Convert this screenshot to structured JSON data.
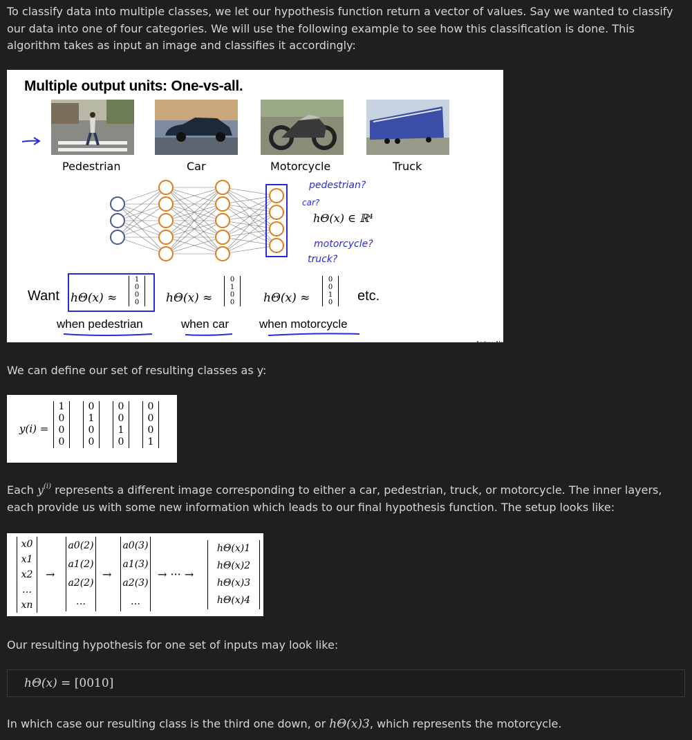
{
  "intro": "To classify data into multiple classes, we let our hypothesis function return a vector of values. Say we wanted to classify our data into one of four categories. We will use the following example to see how this classification is done. This algorithm takes as input an image and classifies it accordingly:",
  "slide": {
    "title": "Multiple output units: One-vs-all.",
    "classes": [
      "Pedestrian",
      "Car",
      "Motorcycle",
      "Truck"
    ],
    "want": "Want",
    "etc": "etc.",
    "when_labels": [
      "when pedestrian",
      "when car",
      "when motorcycle"
    ],
    "hypothesis": "hΘ(x) ≈",
    "vectors": [
      [
        "1",
        "0",
        "0",
        "0"
      ],
      [
        "0",
        "1",
        "0",
        "0"
      ],
      [
        "0",
        "0",
        "1",
        "0"
      ]
    ],
    "annotations": {
      "pedestrian": "pedestrian?",
      "car": "car?",
      "hx_in_r4": "hΘ(x) ∈ ℝ⁴",
      "motorcycle": "motorcycle?",
      "truck": "truck?"
    },
    "credit": "Andrew Ng",
    "network_layers": [
      3,
      5,
      5,
      4
    ]
  },
  "classes_intro": "We can define our set of resulting classes as y:",
  "y_formula": {
    "label": "y(i) =",
    "vectors": [
      [
        "1",
        "0",
        "0",
        "0"
      ],
      [
        "0",
        "1",
        "0",
        "0"
      ],
      [
        "0",
        "0",
        "1",
        "0"
      ],
      [
        "0",
        "0",
        "0",
        "1"
      ]
    ]
  },
  "each_text": {
    "before": "Each ",
    "var": "y",
    "sup": "(i)",
    "after": " represents a different image corresponding to either a car, pedestrian, truck, or motorcycle. The inner layers, each provide us with some new information which leads to our final hypothesis function. The setup looks like:"
  },
  "setup": {
    "input": [
      "x0",
      "x1",
      "x2",
      "…",
      "xn"
    ],
    "layer2": [
      "a0(2)",
      "a1(2)",
      "a2(2)",
      "…"
    ],
    "layer3": [
      "a0(3)",
      "a1(3)",
      "a2(3)",
      "…"
    ],
    "output": [
      "hΘ(x)1",
      "hΘ(x)2",
      "hΘ(x)3",
      "hΘ(x)4"
    ],
    "arrow": "→",
    "ellipsis_arrow": "→ ··· →"
  },
  "result_intro": "Our resulting hypothesis for one set of inputs may look like:",
  "result_formula": {
    "lhs": "hΘ(x) =",
    "rhs": "[0010]"
  },
  "conclusion": {
    "before": "In which case our resulting class is the third one down, or ",
    "math": "hΘ(x)3",
    "after": ", which represents the motorcycle."
  }
}
